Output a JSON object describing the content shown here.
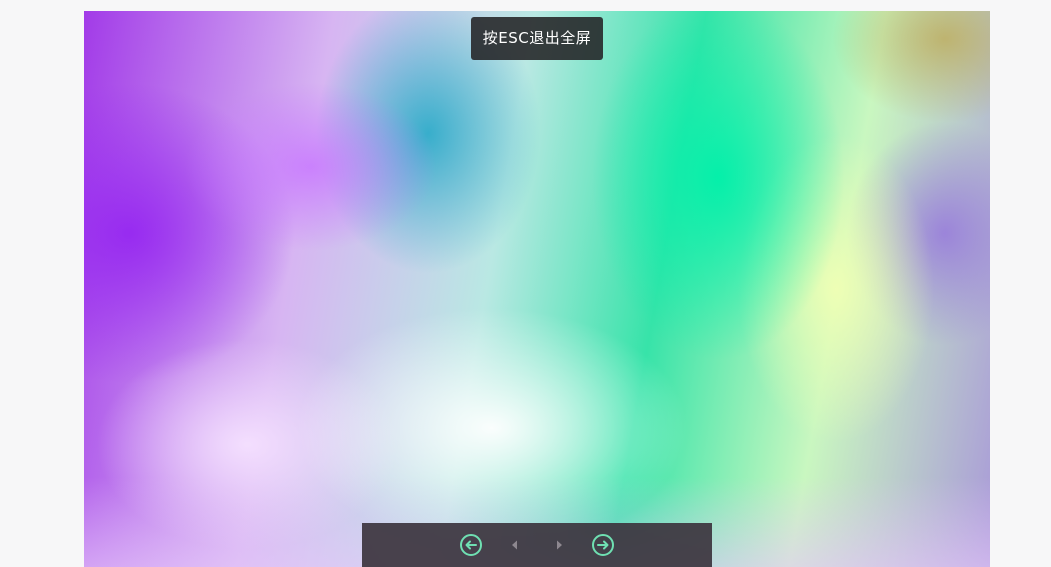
{
  "viewer": {
    "exit_hint": "按ESC退出全屏",
    "colors": {
      "hint_bg": "#232326",
      "controls_bg": "#3c343e",
      "control_accent": "#6fe0b2",
      "control_muted": "#8e8890"
    },
    "controls": {
      "first": {
        "icon": "arrow-left-circle-icon"
      },
      "prev": {
        "icon": "triangle-left-icon"
      },
      "next": {
        "icon": "triangle-right-icon"
      },
      "last": {
        "icon": "arrow-right-circle-icon"
      }
    }
  }
}
